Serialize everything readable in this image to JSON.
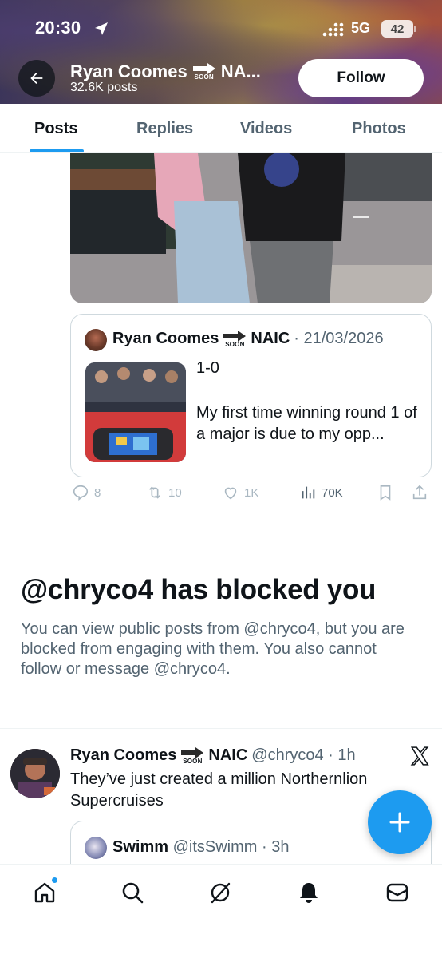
{
  "status_bar": {
    "time": "20:30",
    "network": "5G",
    "battery": "42"
  },
  "header": {
    "name_start": "Ryan Coomes",
    "name_end": "NA...",
    "soon_label": "SOON",
    "post_count": "32.6K posts",
    "follow_label": "Follow"
  },
  "tabs": [
    {
      "label": "Posts",
      "active": true
    },
    {
      "label": "Replies",
      "active": false
    },
    {
      "label": "Videos",
      "active": false
    },
    {
      "label": "Photos",
      "active": false
    }
  ],
  "quoted_post": {
    "author": "Ryan Coomes",
    "soon_label": "SOON",
    "author_suffix": "NAIC",
    "date": "· 21/03/2026",
    "line1": "1-0",
    "text": "My first time winning round 1 of a major is due to my opp..."
  },
  "post_actions": {
    "replies": "8",
    "reposts": "10",
    "likes": "1K",
    "views": "70K"
  },
  "blocked_notice": {
    "title": "@chryco4 has blocked you",
    "description": "You can view public posts from @chryco4, but you are blocked from engaging with them. You also cannot follow or message @chryco4."
  },
  "second_post": {
    "author": "Ryan Coomes",
    "soon_label": "SOON",
    "author_suffix": "NAIC",
    "handle_time": "@chryco4 · 1h",
    "text": "They’ve just created a million Northernlion Supercruises",
    "quote_author": "Swimm",
    "quote_handle_time": "@itsSwimm · 3h"
  },
  "colors": {
    "accent": "#1d9bf0",
    "text_primary": "#0f1419",
    "text_secondary": "#536471",
    "border": "#cfd9de"
  },
  "icons": {
    "back": "arrow-left-icon",
    "location": "location-arrow-icon",
    "compose": "plus-icon",
    "nav": [
      "home-icon",
      "search-icon",
      "grok-icon",
      "notifications-icon",
      "messages-icon"
    ]
  }
}
